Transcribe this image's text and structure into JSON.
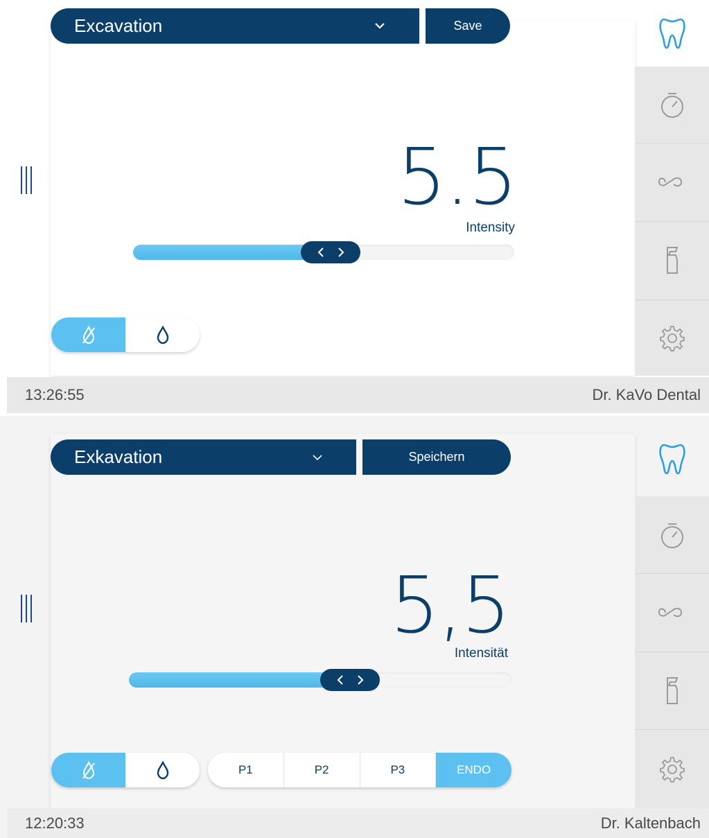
{
  "screens": [
    {
      "mode": "Excavation",
      "save_label": "Save",
      "value": "5.5",
      "value_label": "Intensity",
      "slider_fraction": 0.44,
      "water_toggle": {
        "active": "spray-off"
      },
      "time": "13:26:55",
      "user": "Dr. KaVo Dental"
    },
    {
      "mode": "Exkavation",
      "save_label": "Speichern",
      "value": "5,5",
      "value_label": "Intensität",
      "slider_fraction": 0.5,
      "water_toggle": {
        "active": "spray-off"
      },
      "programs": [
        "P1",
        "P2",
        "P3",
        "ENDO"
      ],
      "active_program": "ENDO",
      "time": "12:20:33",
      "user": "Dr. Kaltenbach"
    }
  ],
  "tools": [
    "tooth-icon",
    "stopwatch-icon",
    "infinity-icon",
    "spray-bottle-icon",
    "gear-icon"
  ],
  "colors": {
    "navy": "#0b3e69",
    "accent": "#5cc1f0",
    "sidebar": "#e7e7e7"
  }
}
